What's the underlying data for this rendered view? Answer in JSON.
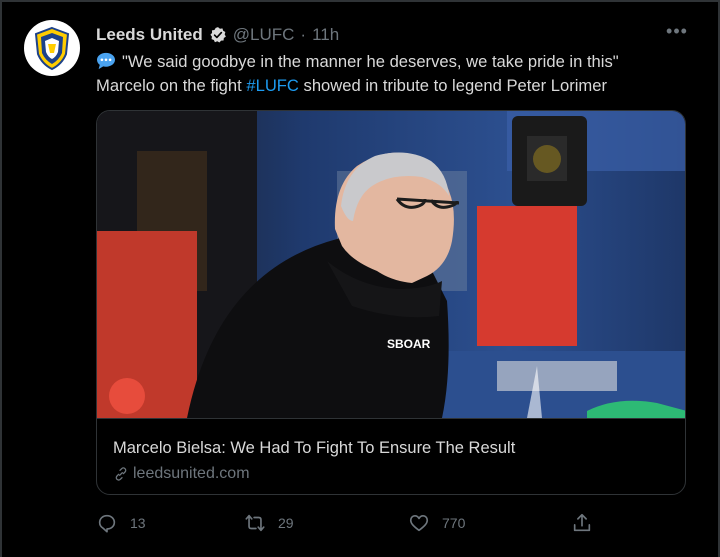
{
  "tweet": {
    "author_name": "Leeds United",
    "handle": "@LUFC",
    "separator": "·",
    "time": "11h",
    "text_line1": "\"We said goodbye in the manner he deserves, we take pride in this\"",
    "text_line2_prefix": "Marcelo on the fight ",
    "hashtag": "#LUFC",
    "text_line2_suffix": " showed in tribute to legend Peter Lorimer"
  },
  "card": {
    "title": "Marcelo Bielsa: We Had To Fight To Ensure The Result",
    "domain": "leedsunited.com",
    "image_text": "SBOAR"
  },
  "actions": {
    "replies": "13",
    "retweets": "29",
    "likes": "770"
  },
  "icons": {
    "verified": "verified-badge-icon",
    "speech": "speech-balloon-icon",
    "link": "link-icon",
    "reply": "reply-icon",
    "retweet": "retweet-icon",
    "like": "heart-icon",
    "share": "share-icon",
    "more": "more-icon"
  },
  "colors": {
    "background": "#000000",
    "accent": "#1d9bf0",
    "muted": "#6e767d",
    "text": "#d9d9d9",
    "border": "#2f3336"
  }
}
